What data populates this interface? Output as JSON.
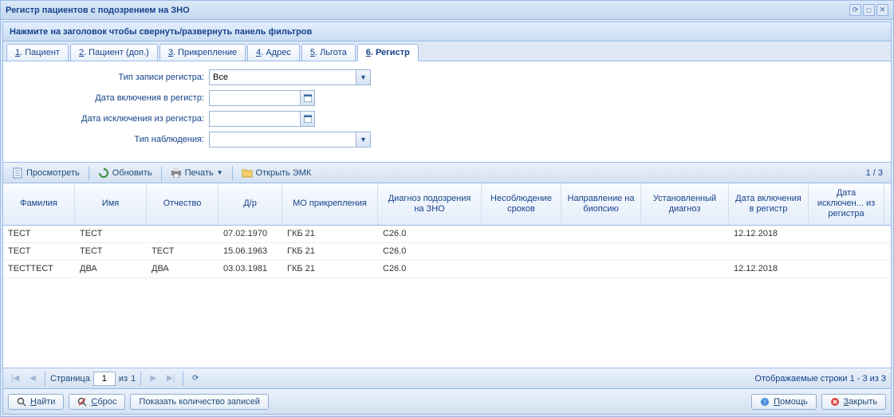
{
  "window": {
    "title": "Регистр пациентов с подозрением на ЗНО"
  },
  "filter": {
    "header": "Нажмите на заголовок чтобы свернуть/развернуть панель фильтров",
    "tabs": [
      {
        "num": "1",
        "label": ". Пациент"
      },
      {
        "num": "2",
        "label": ". Пациент (доп.)"
      },
      {
        "num": "3",
        "label": ". Прикрепление"
      },
      {
        "num": "4",
        "label": ". Адрес"
      },
      {
        "num": "5",
        "label": ". Льгота"
      },
      {
        "num": "6",
        "label": ". Регистр"
      }
    ],
    "fields": {
      "record_type_label": "Тип записи регистра:",
      "record_type_value": "Все",
      "include_date_label": "Дата включения в регистр:",
      "include_date_value": "",
      "exclude_date_label": "Дата исключения из регистра:",
      "exclude_date_value": "",
      "obs_type_label": "Тип наблюдения:",
      "obs_type_value": ""
    }
  },
  "toolbar": {
    "view": "Просмотреть",
    "refresh": "Обновить",
    "print": "Печать",
    "open_emk": "Открыть ЭМК",
    "page_indicator": "1 / 3"
  },
  "grid": {
    "columns": [
      "Фамилия",
      "Имя",
      "Отчество",
      "Д/р",
      "МО прикрепления",
      "Диагноз подозрения на ЗНО",
      "Несоблюдение сроков",
      "Направление на биопсию",
      "Установленный диагноз",
      "Дата включения в регистр",
      "Дата исключен... из регистра"
    ],
    "rows": [
      {
        "fam": "ТЕСТ",
        "name": "ТЕСТ",
        "patr": "",
        "dob": "07.02.1970",
        "mo": "ГКБ 21",
        "diag": "C26.0",
        "nesob": "",
        "napr": "",
        "ust": "",
        "din": "12.12.2018",
        "dout": ""
      },
      {
        "fam": "ТЕСТ",
        "name": "ТЕСТ",
        "patr": "ТЕСТ",
        "dob": "15.06.1963",
        "mo": "ГКБ 21",
        "diag": "C26.0",
        "nesob": "",
        "napr": "",
        "ust": "",
        "din": "",
        "dout": ""
      },
      {
        "fam": "ТЕСТТЕСТ",
        "name": "ДВА",
        "patr": "ДВА",
        "dob": "03.03.1981",
        "mo": "ГКБ 21",
        "diag": "C26.0",
        "nesob": "",
        "napr": "",
        "ust": "",
        "din": "12.12.2018",
        "dout": ""
      }
    ]
  },
  "paging": {
    "page_label_prefix": "Страница",
    "page_value": "1",
    "page_label_mid": "из",
    "page_total": "1",
    "display_text": "Отображаемые строки 1 - 3 из 3"
  },
  "buttons": {
    "find_u": "Н",
    "find_rest": "айти",
    "reset_u": "С",
    "reset_rest": "брос",
    "show_count": "Показать количество записей",
    "help_u": "П",
    "help_rest": "омощь",
    "close_u": "З",
    "close_rest": "акрыть"
  }
}
